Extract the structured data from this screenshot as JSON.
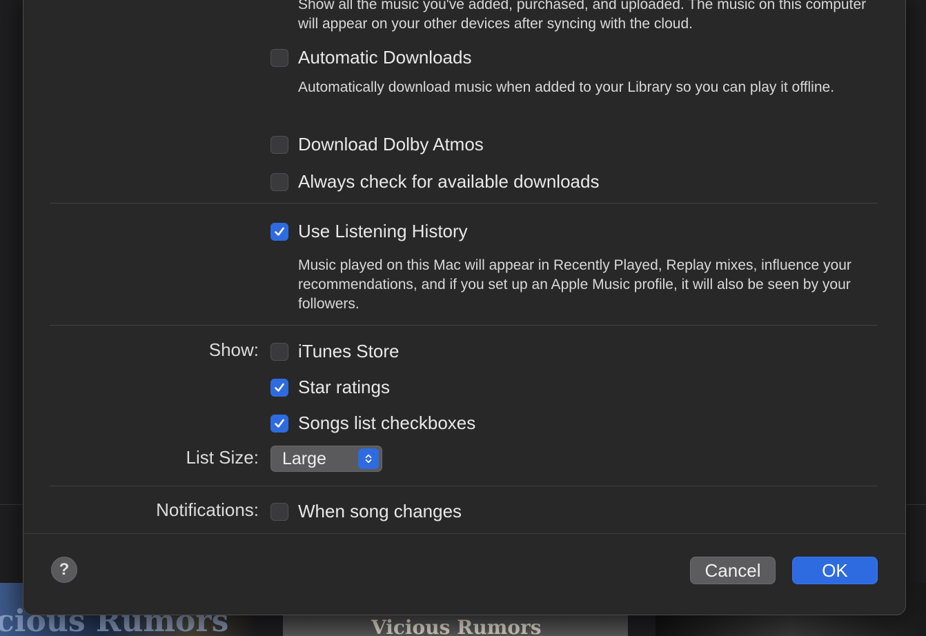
{
  "background": {
    "album_art": [
      {
        "text": "cious Rumors"
      },
      {
        "text": "Vicious Rumors"
      },
      {
        "text": ""
      }
    ]
  },
  "sync_description": "Show all the music you've added, purchased, and uploaded. The music on this computer will appear on your other devices after syncing with the cloud.",
  "options": {
    "automatic_downloads": {
      "label": "Automatic Downloads",
      "checked": false,
      "description": "Automatically download music when added to your Library so you can play it offline."
    },
    "dolby_atmos": {
      "label": "Download Dolby Atmos",
      "checked": false
    },
    "check_downloads": {
      "label": "Always check for available downloads",
      "checked": false
    },
    "listening_history": {
      "label": "Use Listening History",
      "checked": true,
      "description": "Music played on this Mac will appear in Recently Played, Replay mixes, influence your recommendations, and if you set up an Apple Music profile, it will also be seen by your followers."
    }
  },
  "show": {
    "label": "Show:",
    "itunes_store": {
      "label": "iTunes Store",
      "checked": false
    },
    "star_ratings": {
      "label": "Star ratings",
      "checked": true
    },
    "songs_checkboxes": {
      "label": "Songs list checkboxes",
      "checked": true
    }
  },
  "list_size": {
    "label": "List Size:",
    "value": "Large"
  },
  "notifications": {
    "label": "Notifications:",
    "song_changes": {
      "label": "When song changes",
      "checked": false
    }
  },
  "footer": {
    "help": "?",
    "cancel": "Cancel",
    "ok": "OK"
  },
  "colors": {
    "accent": "#2f6be0",
    "sheet_bg": "#282828"
  }
}
